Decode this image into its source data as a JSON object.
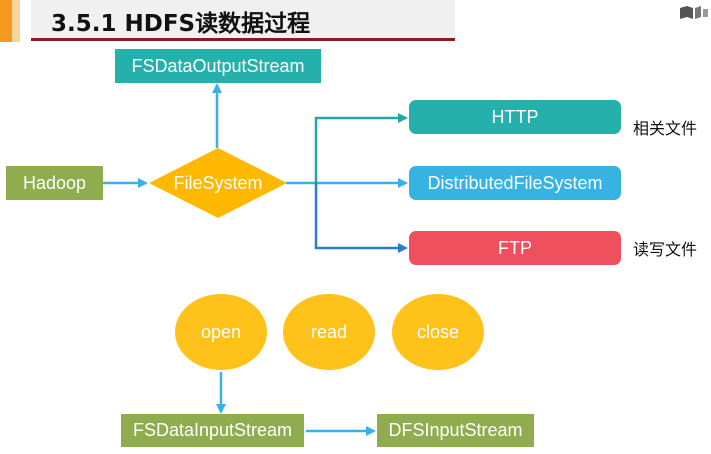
{
  "header": {
    "title": "3.5.1 HDFS读数据过程"
  },
  "diagram": {
    "hadoop": "Hadoop",
    "filesystem": "FileSystem",
    "output_stream": "FSDataOutputStream",
    "http": "HTTP",
    "distributed": "DistributedFileSystem",
    "ftp": "FTP",
    "related_files": "相关文件",
    "read_write_files": "读写文件",
    "open": "open",
    "read": "read",
    "close": "close",
    "input_stream": "FSDataInputStream",
    "dfs_input": "DFSInputStream"
  },
  "colors": {
    "accent": "#f39a1e",
    "title_underline": "#8b1a1a",
    "green_box": "#8fac4f",
    "teal_box": "#26b0ab",
    "blue_box": "#36b2e3",
    "red_box": "#f04f5e",
    "diamond": "#ffb800",
    "circle": "#ffc21a",
    "arrow_blue": "#39b1e4",
    "arrow_dark_blue": "#2c7cd4",
    "arrow_teal": "#21a8a4"
  }
}
